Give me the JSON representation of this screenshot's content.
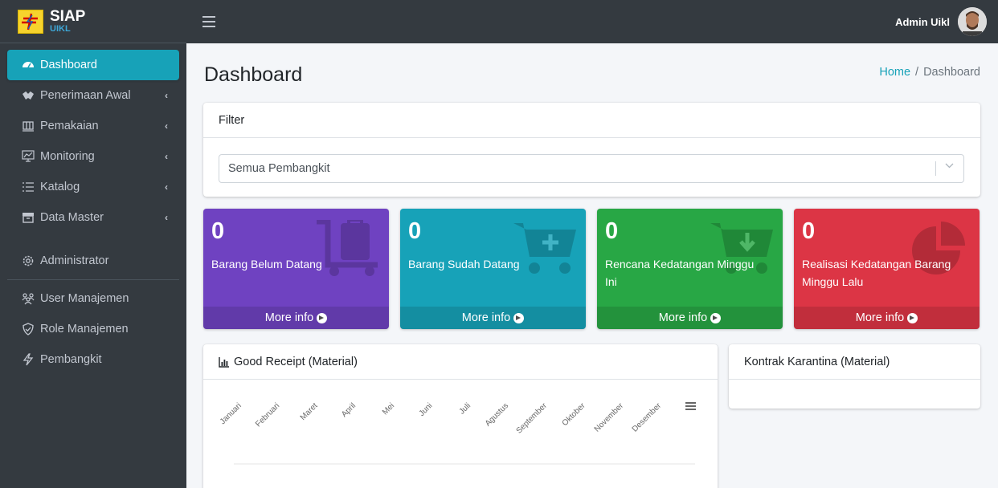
{
  "brand": {
    "title": "SIAP",
    "subtitle": "UIKL"
  },
  "sidebar": {
    "items": [
      {
        "label": "Dashboard",
        "icon": "dashboard-icon"
      },
      {
        "label": "Penerimaan Awal",
        "icon": "hands-helping-icon"
      },
      {
        "label": "Pemakaian",
        "icon": "dolly-icon"
      },
      {
        "label": "Monitoring",
        "icon": "monitor-chart-icon"
      },
      {
        "label": "Katalog",
        "icon": "list-icon"
      },
      {
        "label": "Data Master",
        "icon": "archive-icon"
      }
    ],
    "admin": {
      "label": "Administrator",
      "icon": "gear-icon"
    },
    "admin_items": [
      {
        "label": "User Manajemen",
        "icon": "users-icon"
      },
      {
        "label": "Role Manajemen",
        "icon": "shield-check-icon"
      },
      {
        "label": "Pembangkit",
        "icon": "power-icon"
      }
    ]
  },
  "topbar": {
    "user_name": "Admin Uikl"
  },
  "page": {
    "title": "Dashboard"
  },
  "breadcrumb": {
    "home": "Home",
    "current": "Dashboard"
  },
  "filter": {
    "title": "Filter",
    "selected": "Semua Pembangkit"
  },
  "stats": [
    {
      "value": "0",
      "label": "Barang Belum Datang",
      "more": "More info",
      "color": "#6f42c1",
      "icon": "luggage-cart-icon"
    },
    {
      "value": "0",
      "label": "Barang Sudah Datang",
      "more": "More info",
      "color": "#17a2b8",
      "icon": "cart-plus-icon"
    },
    {
      "value": "0",
      "label": "Rencana Kedatangan Minggu Ini",
      "more": "More info",
      "color": "#28a745",
      "icon": "cart-download-icon"
    },
    {
      "value": "0",
      "label": "Realisasi Kedatangan Barang Minggu Lalu",
      "more": "More info",
      "color": "#dc3545",
      "icon": "pie-chart-icon"
    }
  ],
  "good_receipt": {
    "title": "Good Receipt (Material)",
    "months": [
      "Januari",
      "Februari",
      "Maret",
      "April",
      "Mei",
      "Juni",
      "Juli",
      "Agustus",
      "September",
      "Oktober",
      "November",
      "Desember"
    ]
  },
  "kontrak": {
    "title": "Kontrak Karantina (Material)"
  }
}
